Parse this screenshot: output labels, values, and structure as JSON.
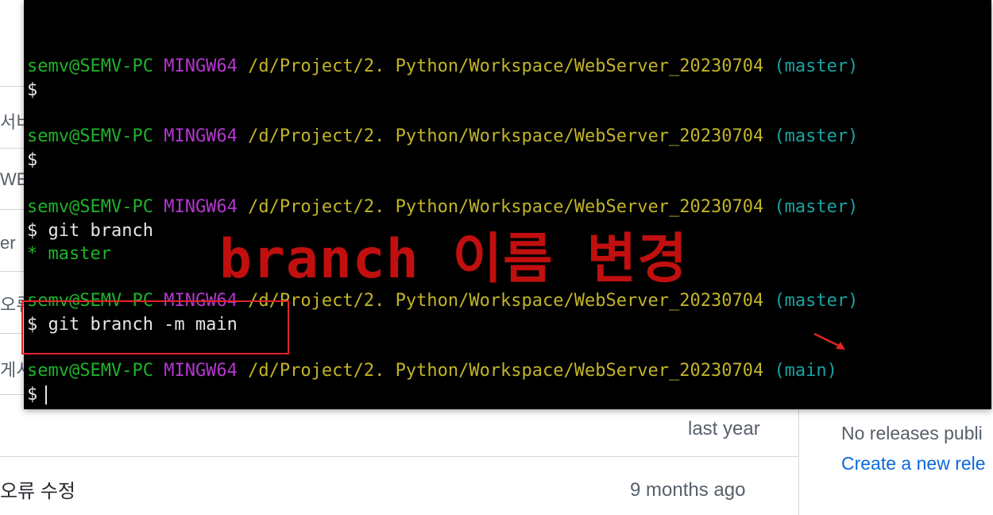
{
  "terminal": {
    "prompt": {
      "user": "semv@SEMV-PC",
      "host": "MINGW64",
      "path": "/d/Project/2. Python/Workspace/WebServer_20230704"
    },
    "lines": [
      {
        "branch": "(master)",
        "command": "$"
      },
      {
        "branch": "(master)",
        "command": "$"
      },
      {
        "branch": "(master)",
        "command": "$ git branch",
        "output": "* master"
      },
      {
        "branch": "(master)",
        "command": "$ git branch -m main"
      },
      {
        "branch": "(main)",
        "command": "$"
      }
    ]
  },
  "annotation": {
    "title": "branch 이름 변경",
    "highlight_color": "#e02424",
    "arrow_color": "#e02424"
  },
  "background": {
    "left_edge_texts": [
      "서비",
      "WE",
      "er",
      "오류",
      "게시"
    ],
    "rows": [
      {
        "time": "last year"
      },
      {
        "message": "오류 수정",
        "time": "9 months ago"
      }
    ],
    "sidebar": {
      "no_releases": "No releases publi",
      "create_release_link": "Create a new rele"
    }
  }
}
